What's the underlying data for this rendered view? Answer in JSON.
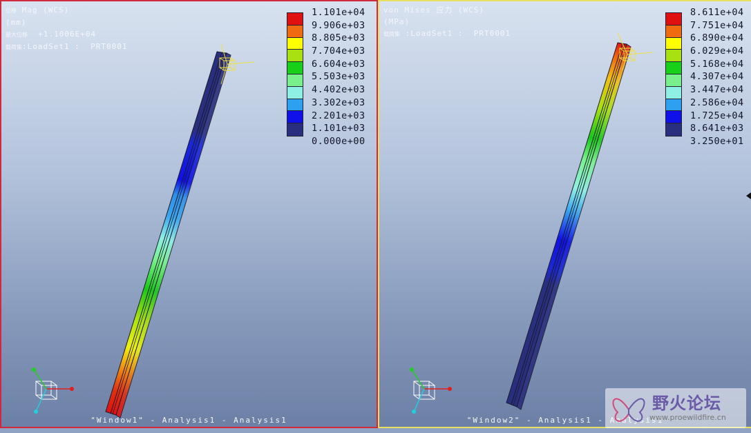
{
  "windows": [
    {
      "id": "Window1",
      "header": {
        "line1": "Mag (WCS)",
        "line1_prefix": "位移",
        "line2": "(mm)",
        "line3_prefix": "最大位移",
        "line3": "+1.1006E+04",
        "line4_prefix": "载荷集",
        "line4": ":LoadSet1 :  PRT0001"
      },
      "legend": {
        "colors": [
          "#e01010",
          "#f06a10",
          "#ffff00",
          "#a8e010",
          "#18d018",
          "#7af08c",
          "#8ef0e4",
          "#2ea0f0",
          "#1010e8",
          "#2a2e7e"
        ],
        "values": [
          "1.101e+04",
          "9.906e+03",
          "8.805e+03",
          "7.704e+03",
          "6.604e+03",
          "5.503e+03",
          "4.402e+03",
          "3.302e+03",
          "2.201e+03",
          "1.101e+03",
          "0.000e+00"
        ]
      },
      "footer": "\"Window1\" - Analysis1 - Analysis1"
    },
    {
      "id": "Window2",
      "header": {
        "line1": "von Mises 应力 (WCS)",
        "line1_prefix": "",
        "line2": "(MPa)",
        "line3_prefix": "载荷集",
        "line3": ":LoadSet1 :  PRT0001",
        "line4_prefix": "",
        "line4": ""
      },
      "legend": {
        "colors": [
          "#e01010",
          "#f06a10",
          "#ffff00",
          "#a8e010",
          "#18d018",
          "#7af08c",
          "#8ef0e4",
          "#2ea0f0",
          "#1010e8",
          "#2a2e7e"
        ],
        "values": [
          "8.611e+04",
          "7.751e+04",
          "6.890e+04",
          "6.029e+04",
          "5.168e+04",
          "4.307e+04",
          "3.447e+04",
          "2.586e+04",
          "1.725e+04",
          "8.641e+03",
          "3.250e+01"
        ]
      },
      "footer": "\"Window2\" - Analysis1 - Analysis1"
    }
  ],
  "triad": {
    "x": "x",
    "y": "y",
    "z": "z"
  },
  "watermark": {
    "text": "野火论坛",
    "url": "www.proewildfire.cn"
  }
}
